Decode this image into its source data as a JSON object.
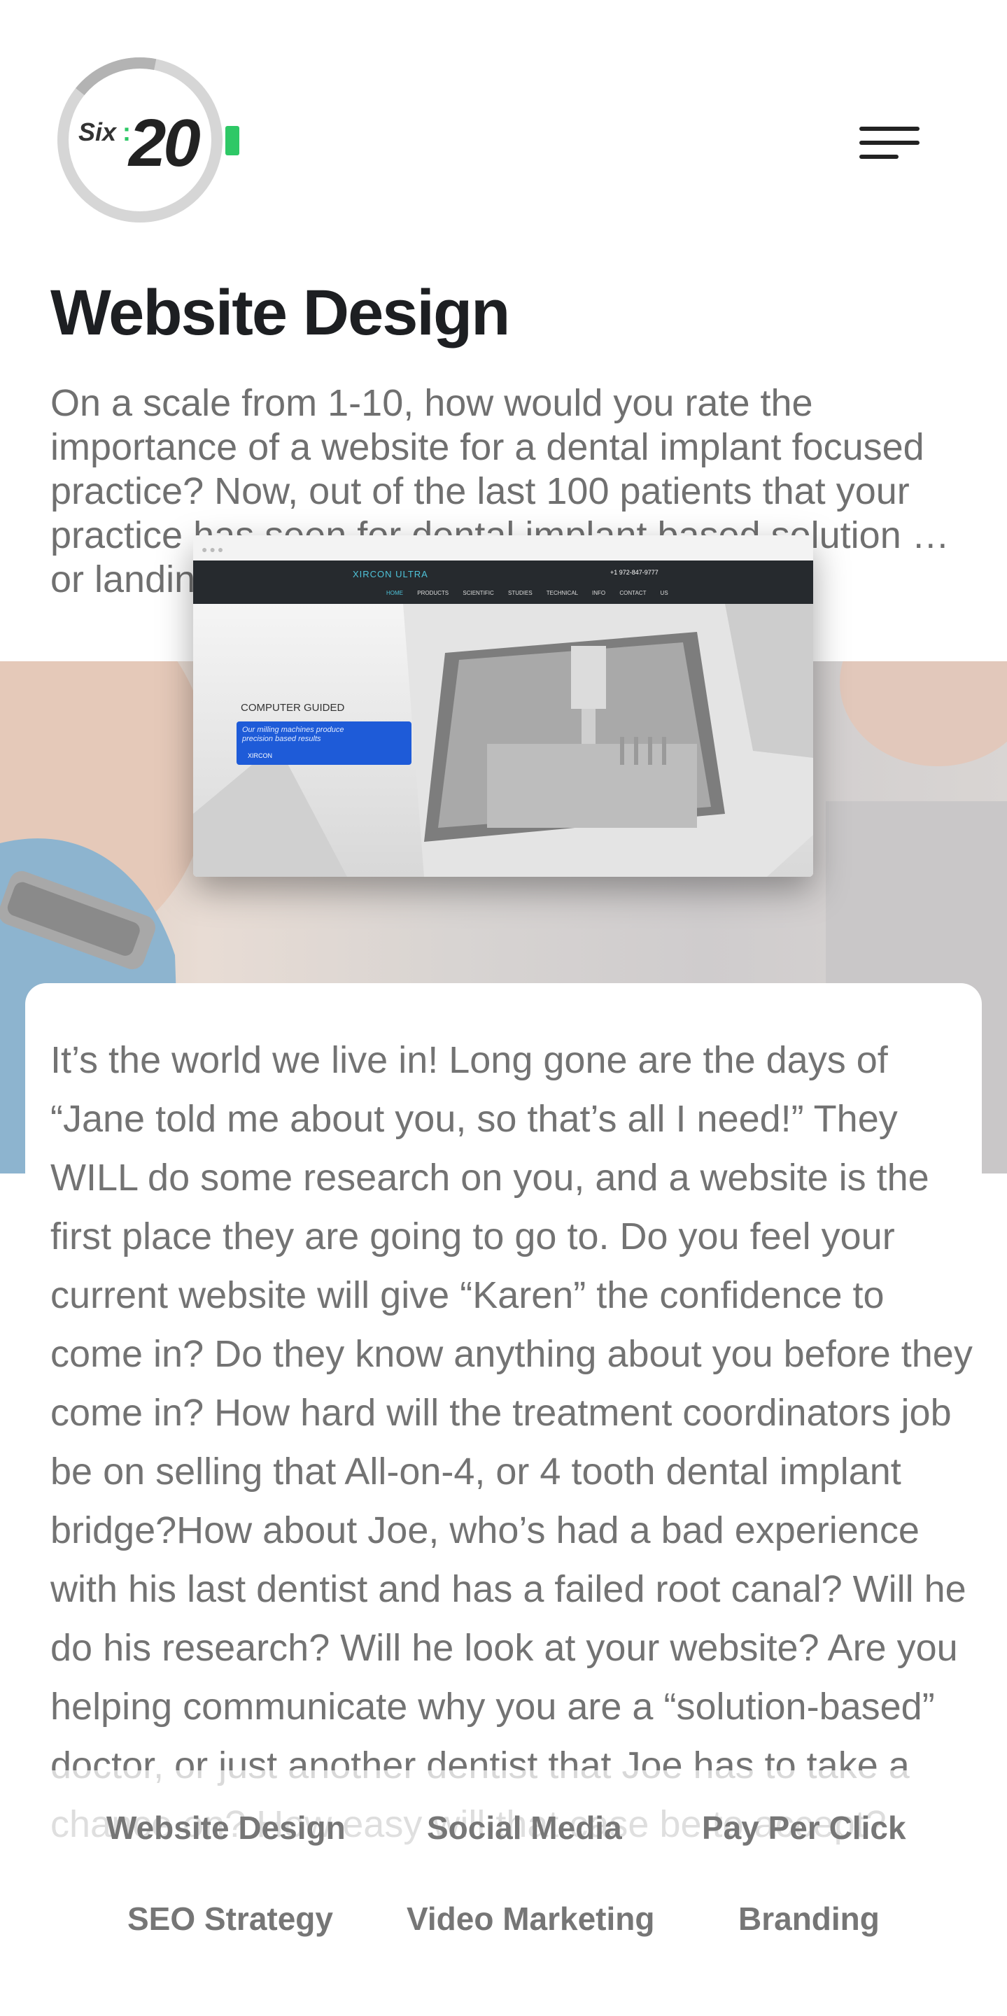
{
  "header": {
    "logo_prefix": "Six",
    "logo_separator": ":",
    "logo_number": "20",
    "brand_green": "#2ec866",
    "menu_icon": "hamburger-menu-icon"
  },
  "page": {
    "title": "Website Design",
    "intro": "On a scale from 1-10, how would you rate the importance of a website for a dental implant focused practice? Now, out of the last 100 patients that your practice has seen for dental implant based solution … or landing …"
  },
  "mockup": {
    "brand": "XIRCON ULTRA",
    "phone": "+1 972-847-9777",
    "nav": [
      "HOME",
      "PRODUCTS",
      "SCIENTIFIC STUDIES",
      "TECHNICAL INFO",
      "CONTACT US"
    ],
    "card_title": "COMPUTER GUIDED",
    "card_text": "Our milling machines produce precision based results",
    "card_logo": "XIRCON"
  },
  "article": {
    "body": "It’s the world we live in! Long gone are the days of “Jane told me about you, so that’s all I need!” They WILL do some research on you, and a website is the first place they are going to go to. Do you feel your current website will give “Karen” the confidence to come in? Do they know anything about you before they come in? How hard will the treatment coordinators job be on selling that All-on-4, or 4 tooth dental implant bridge?How about Joe, who’s had a bad experience with his last dentist and has a failed root canal? Will he do his research? Will he look at your website? Are you helping communicate why you are a “solution-based” doctor, or just another dentist that Joe has to take a chance on? How easy will that case be to accept?"
  },
  "services": [
    "Website Design",
    "Social Media",
    "Pay Per Click",
    "SEO Strategy",
    "Video Marketing",
    "Branding"
  ]
}
